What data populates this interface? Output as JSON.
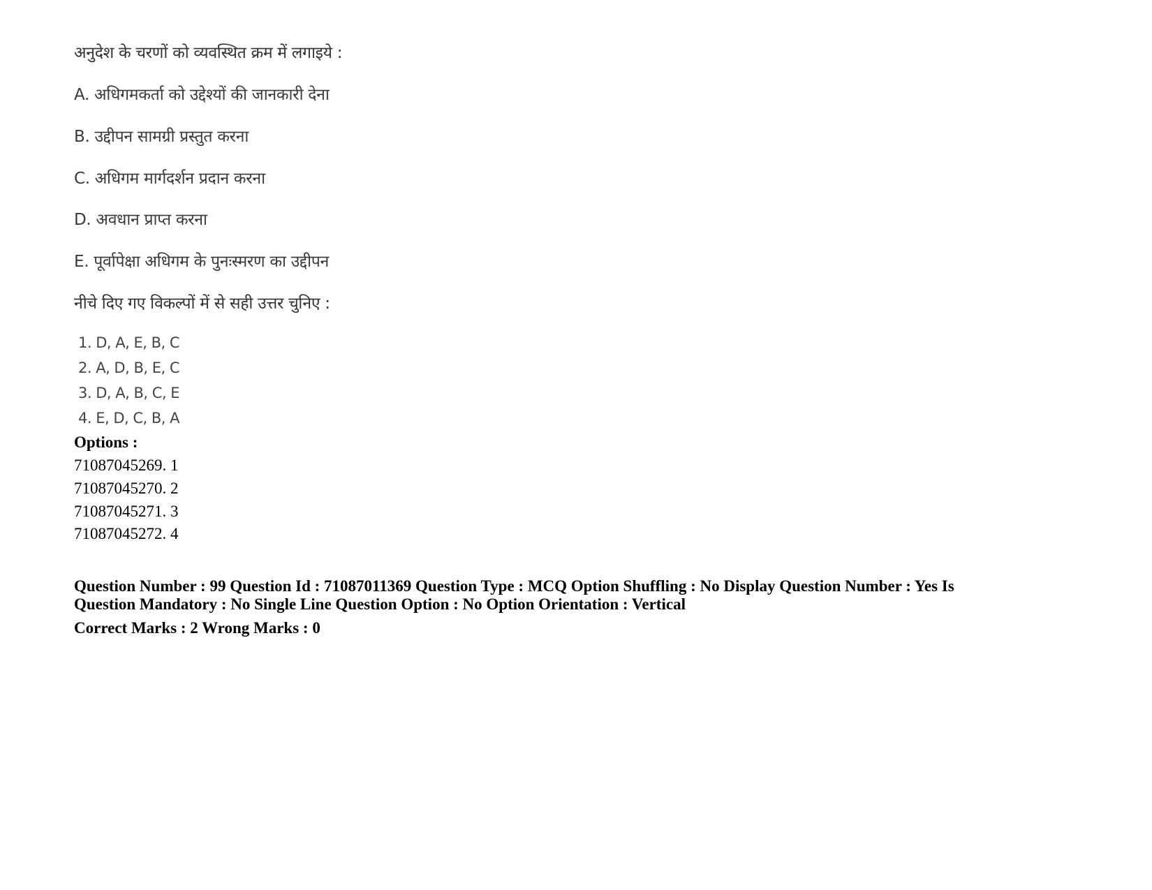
{
  "question": {
    "prompt": "अनुदेश के चरणों को व्यवस्थित क्रम में लगाइये :",
    "statements": [
      "A. अधिगमकर्ता को उद्देश्यों की जानकारी देना",
      "B. उद्दीपन सामग्री प्रस्तुत करना",
      "C. अधिगम मार्गदर्शन प्रदान करना",
      "D. अवधान प्राप्त करना",
      "E. पूर्वापेक्षा अधिगम के पुनःस्मरण का उद्दीपन"
    ],
    "instruction": "नीचे दिए गए विकल्पों में से सही उत्तर चुनिए :",
    "choices": [
      "1. D, A, E, B, C",
      "2. A, D, B, E, C",
      "3. D, A, B, C, E",
      "4. E, D, C, B, A"
    ]
  },
  "options": {
    "heading": "Options :",
    "items": [
      "71087045269. 1",
      "71087045270. 2",
      "71087045271. 3",
      "71087045272. 4"
    ]
  },
  "meta": {
    "line1": "Question Number : 99 Question Id : 71087011369 Question Type : MCQ Option Shuffling : No Display Question Number : Yes Is",
    "line2": "Question Mandatory : No Single Line Question Option : No Option Orientation : Vertical",
    "marks": "Correct Marks : 2 Wrong Marks : 0"
  }
}
